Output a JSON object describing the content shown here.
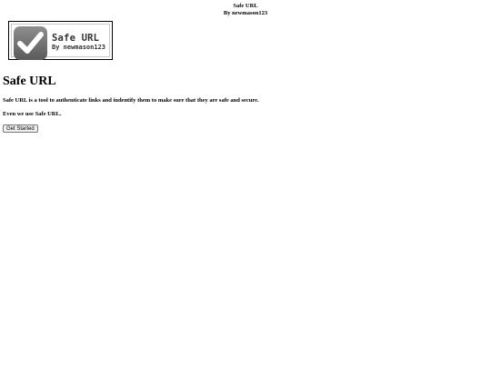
{
  "banner": {
    "title": "Safe URL",
    "byline": "By newmason123"
  },
  "logo": {
    "title": "Safe URL",
    "subtitle": "By newmason123",
    "icon": "checkmark-icon"
  },
  "main": {
    "heading": "Safe URL",
    "description": "Safe URL is a tool to authenticate links and indentify them to make sure that they are safe and secure.",
    "note": "Even we use Safe URL.",
    "button_label": "Get Started"
  }
}
